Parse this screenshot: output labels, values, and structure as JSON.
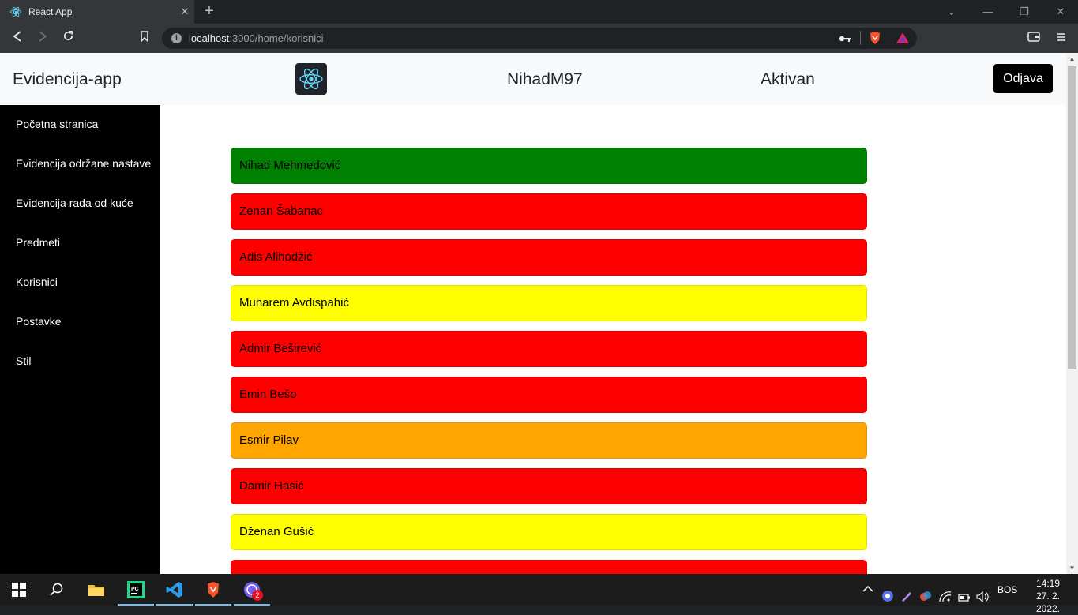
{
  "browser": {
    "tab_title": "React App",
    "tab_close": "✕",
    "new_tab": "+",
    "url_host": "localhost",
    "url_rest": ":3000/home/korisnici"
  },
  "app": {
    "brand": "Evidencija-app",
    "username": "NihadM97",
    "status": "Aktivan",
    "logout_label": "Odjava",
    "logo_icon": "react-atom-icon"
  },
  "sidebar": {
    "items": [
      {
        "label": "Početna stranica"
      },
      {
        "label": "Evidencija održane nastave"
      },
      {
        "label": "Evidencija rada od kuće"
      },
      {
        "label": "Predmeti"
      },
      {
        "label": "Korisnici"
      },
      {
        "label": "Postavke"
      },
      {
        "label": "Stil"
      }
    ]
  },
  "users": [
    {
      "name": "Nihad Mehmedović",
      "color": "#008000"
    },
    {
      "name": "Zenan Šabanac",
      "color": "#ff0000"
    },
    {
      "name": "Adis Alihodžić",
      "color": "#ff0000"
    },
    {
      "name": "Muharem Avdispahić",
      "color": "#ffff00"
    },
    {
      "name": "Admir Beširević",
      "color": "#ff0000"
    },
    {
      "name": "Emin Bešo",
      "color": "#ff0000"
    },
    {
      "name": "Esmir Pilav",
      "color": "#ffa500"
    },
    {
      "name": "Damir Hasić",
      "color": "#ff0000"
    },
    {
      "name": "Dženan Gušić",
      "color": "#ffff00"
    },
    {
      "name": "",
      "color": "#ff0000"
    }
  ],
  "taskbar": {
    "language": "BOS",
    "time": "14:19",
    "date": "27. 2. 2022.",
    "viber_badge": "2"
  }
}
